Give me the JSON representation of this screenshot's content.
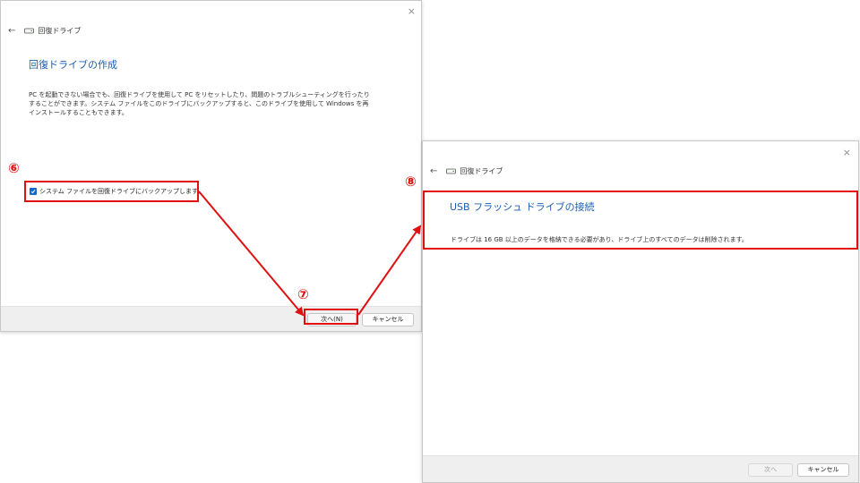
{
  "dialog1": {
    "close_glyph": "×",
    "back_glyph": "←",
    "app_title": "回復ドライブ",
    "heading": "回復ドライブの作成",
    "description": "PC を起動できない場合でも、回復ドライブを使用して PC をリセットしたり、問題のトラブルシューティングを行ったりすることができます。システム ファイルをこのドライブにバックアップすると、このドライブを使用して Windows を再インストールすることもできます。",
    "checkbox_label": "システム ファイルを回復ドライブにバックアップします。",
    "checkbox_checked": true,
    "next_button": "次へ(N)",
    "cancel_button": "キャンセル"
  },
  "dialog2": {
    "close_glyph": "×",
    "back_glyph": "←",
    "app_title": "回復ドライブ",
    "heading": "USB フラッシュ ドライブの接続",
    "description": "ドライブは 16 GB 以上のデータを格納できる必要があり、ドライブ上のすべてのデータは削除されます。",
    "next_button": "次へ",
    "next_enabled": false,
    "cancel_button": "キャンセル"
  },
  "annotations": {
    "step6": "⑥",
    "step7": "⑦",
    "step8": "⑧",
    "color": "#e01010"
  },
  "icons": {
    "drive": "drive-icon",
    "back": "back-arrow-icon",
    "close": "close-icon",
    "check": "checkmark-icon"
  }
}
